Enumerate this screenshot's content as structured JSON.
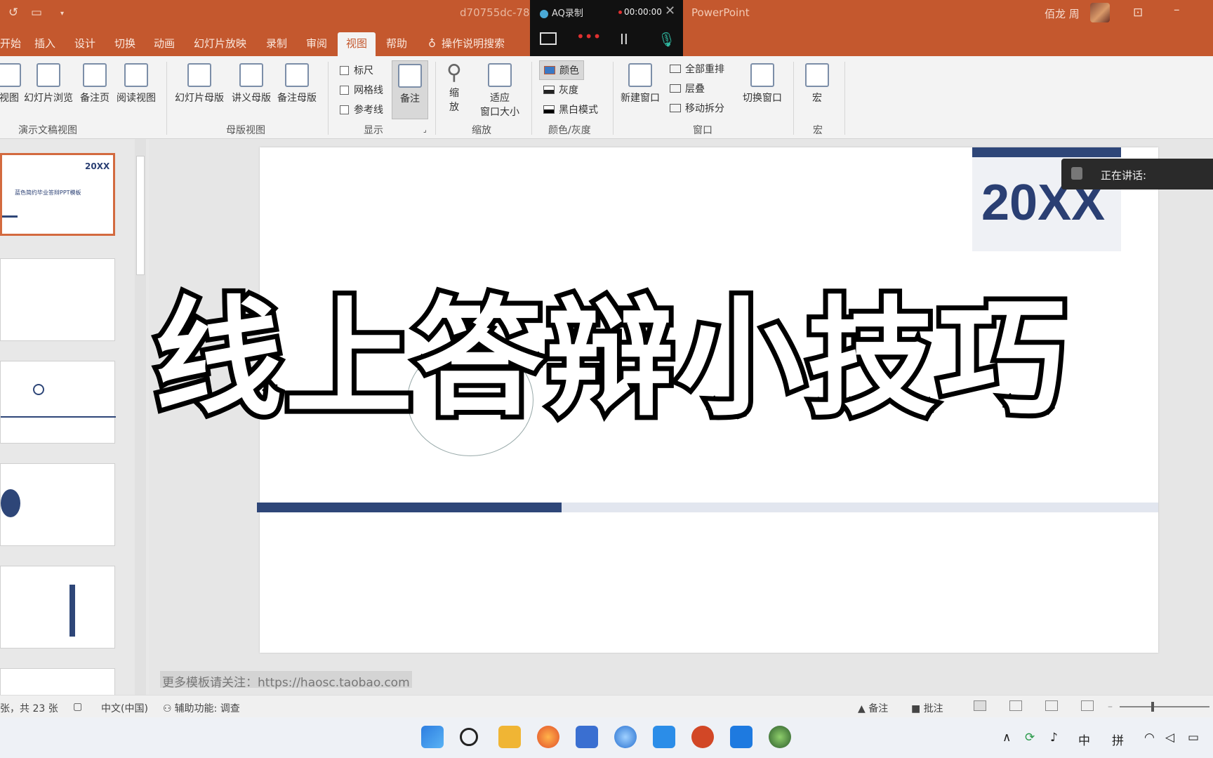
{
  "window": {
    "doc_title": "d70755dc-78",
    "app_name": "PowerPoint",
    "user_name": "佰龙 周",
    "accent_color": "#c4582e"
  },
  "recorder": {
    "title": "AQ录制",
    "timer": "00:00:00",
    "close_icon": "close-icon",
    "dots": "•••",
    "pause": "II"
  },
  "tabs": [
    {
      "label": "开始"
    },
    {
      "label": "插入"
    },
    {
      "label": "设计"
    },
    {
      "label": "切换"
    },
    {
      "label": "动画"
    },
    {
      "label": "幻灯片放映"
    },
    {
      "label": "录制"
    },
    {
      "label": "审阅"
    },
    {
      "label": "视图"
    },
    {
      "label": "帮助"
    }
  ],
  "tell_me": "操作说明搜索",
  "ribbon": {
    "presentation_views": {
      "view": "视图",
      "slide_sorter": "幻灯片浏览",
      "notes_page": "备注页",
      "reading_view": "阅读视图",
      "group": "演示文稿视图"
    },
    "master_views": {
      "slide_master": "幻灯片母版",
      "handout_master": "讲义母版",
      "notes_master": "备注母版",
      "group": "母版视图"
    },
    "show": {
      "ruler": "标尺",
      "gridlines": "网格线",
      "guides": "参考线",
      "notes": "备注",
      "group": "显示"
    },
    "zoom": {
      "zoom_1": "缩",
      "zoom_2": "放",
      "fit_1": "适应",
      "fit_2": "窗口大小",
      "group": "缩放"
    },
    "color": {
      "color": "颜色",
      "grayscale": "灰度",
      "bw": "黑白模式",
      "group": "颜色/灰度"
    },
    "window": {
      "new_window": "新建窗口",
      "arrange_all": "全部重排",
      "cascade": "层叠",
      "move_split": "移动拆分",
      "switch_windows": "切换窗口",
      "group": "窗口"
    },
    "macros": {
      "macros": "宏",
      "group": "宏"
    }
  },
  "thumbnails": {
    "slide1_year": "20XX",
    "slide1_title": "蓝色简约毕业答辩PPT模板"
  },
  "slide": {
    "year": "20XX"
  },
  "speaking": "正在讲话:",
  "caption": "线上答辩小技巧",
  "notes_text": "更多模板请关注：https://haosc.taobao.com",
  "status": {
    "slide_count": "张，共 23 张",
    "language": "中文(中国)",
    "accessibility": "辅助功能: 调查",
    "notes": "备注",
    "comments": "批注"
  },
  "tray": {
    "ime_mode": "中",
    "ime_name": "拼"
  }
}
